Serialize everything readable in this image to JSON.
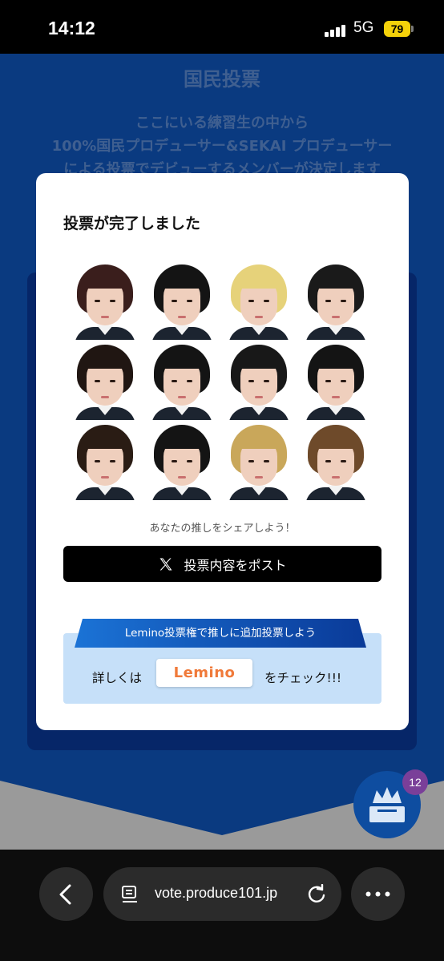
{
  "status_bar": {
    "time": "14:12",
    "network": "5G",
    "battery": "79"
  },
  "page": {
    "section_title": "国民投票",
    "description_lines": [
      "ここにいる練習生の中から",
      "100%国民プロデューサー&SEKAI プロデューサー",
      "による投票でデビューするメンバーが決定します"
    ]
  },
  "modal": {
    "title": "投票が完了しました",
    "share_prompt": "あなたの推しをシェアしよう！",
    "post_button_label": "投票内容をポスト",
    "lemino_banner": "Lemino投票権で推しに追加投票しよう",
    "details_prefix": "詳しくは",
    "lemino_logo_text": "Lemino",
    "details_suffix": "をチェック!!!"
  },
  "vote_fab": {
    "badge_count": "12"
  },
  "browser": {
    "url": "vote.produce101.jp"
  },
  "colors": {
    "page_bg": "#0a3a80",
    "accent": "#0e4da0",
    "lemino_orange": "#f07a3a"
  }
}
